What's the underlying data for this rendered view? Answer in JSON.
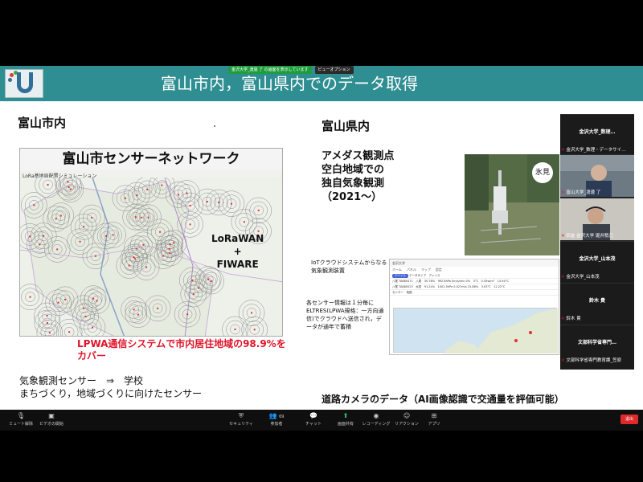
{
  "share_banner": {
    "label": "金沢大学_渡邊 了 の画面を表示しています",
    "view_options": "ビューオプション"
  },
  "slide": {
    "title": "富山市内，富山県内でのデータ取得",
    "section_left": "富山市内",
    "section_right": "富山県内",
    "map_title": "富山市センサーネットワーク",
    "map_subtitle": "LoRa基地局配置シミュレーション",
    "lora_line1": "LoRaWAN",
    "lora_line2": "+",
    "lora_line3": "FIWARE",
    "lpwa_text": "LPWA通信システムで市内居住地域の98.9%をカバー",
    "bullet1": "気象観測センサー　⇒　学校",
    "bullet2": "まちづくり，地域づくりに向けたセンサー",
    "amedas_line1": "アメダス観測点",
    "amedas_line2": "空白地域での",
    "amedas_line3": "独自気象観測",
    "amedas_line4": "（2021～）",
    "photo_label": "氷見",
    "iot_text": "IoTクラウドシステムからなる気象観測装置",
    "sensor_text": "各センサー情報は１分毎にELTRES(LPWA規格：一方向通信)でクラウドへ送信され，データが通年で蓄積",
    "road_camera": "道路カメラのデータ（AI画像認識で交通量を評価可能）",
    "dashboard": {
      "brand": "金沢大学",
      "tabs": [
        "ホーム",
        "パネル",
        "マップ",
        "設定"
      ],
      "pill": "デバイス",
      "tab_extra": "データタイプ　アレイス",
      "row1": "八尾 TA880471　八尾　30.78%　992.8hPa 0m/s/min 0%　3°C　0.55w/m³　14.94°C",
      "row2": "八尾 TA880523　水見　91.24%　1001.5hPa 0.027m/s 15.88%　3.03°C　12.22°C",
      "map_label": "センサー　地図"
    }
  },
  "participants": [
    {
      "name": "金沢大学_数理…",
      "label": "金沢大学_数理・データサイ…"
    },
    {
      "label": "富山大学_渡邊 了"
    },
    {
      "label": "四金 金沢大学 堀井稍己"
    },
    {
      "name": "金沢大学_山本茂",
      "label": "金沢大学_山本茂"
    },
    {
      "name": "鈴木 貴",
      "label": "鈴木 貴"
    },
    {
      "name": "文部科学省専門…",
      "label": "文部科学省専門教育課_笠原"
    }
  ],
  "toolbar": {
    "mute": "ミュート解除",
    "video": "ビデオの開始",
    "security": "セキュリティ",
    "participants": "参加者",
    "participants_count": "69",
    "chat": "チャット",
    "share": "画面共有",
    "record": "レコーディング",
    "reaction": "リアクション",
    "apps": "アプリ",
    "end": "退出"
  }
}
